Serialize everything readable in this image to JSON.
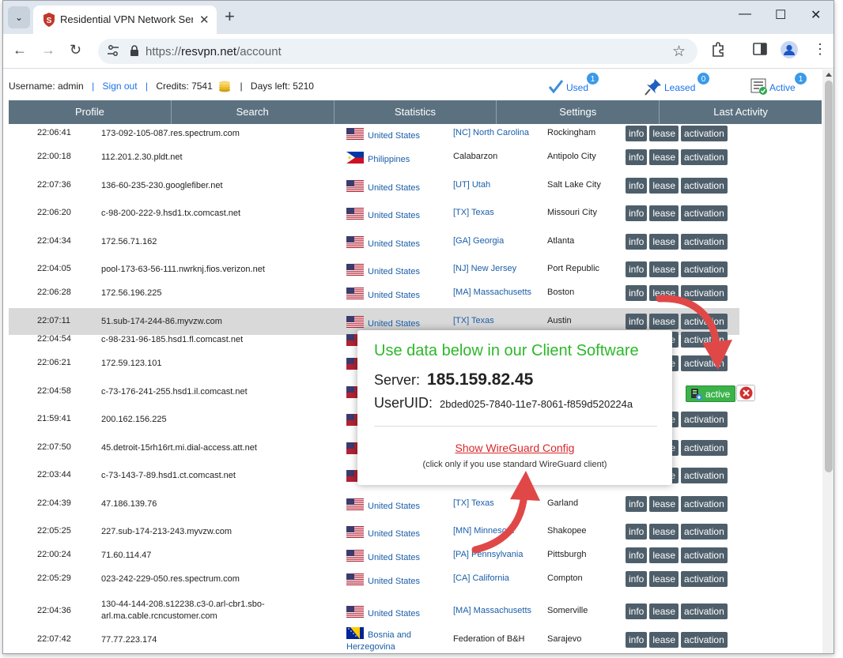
{
  "browser": {
    "tab_title": "Residential VPN Network Servic",
    "url_scheme": "https://",
    "url_host": "resvpn.net",
    "url_path": "/account"
  },
  "account": {
    "username_label": "Username: admin",
    "signout": "Sign out",
    "credits_label": "Credits: 7541",
    "days_label": "Days left: 5210"
  },
  "stats": {
    "used_label": "Used",
    "used_count": "1",
    "leased_label": "Leased",
    "leased_count": "0",
    "active_label": "Active",
    "active_count": "1"
  },
  "menu": [
    "Profile",
    "Search",
    "Statistics",
    "Settings",
    "Last Activity"
  ],
  "row_buttons": {
    "info": "info",
    "lease": "lease",
    "activation": "activation",
    "active": "active"
  },
  "rows": [
    {
      "time": "22:06:41",
      "host": "173-092-105-087.res.spectrum.com",
      "country": "United States",
      "region": "[NC] North Carolina",
      "city": "Rockingham"
    },
    {
      "time": "22:00:18",
      "host": "112.201.2.30.pldt.net",
      "country": "Philippines",
      "region": "Calabarzon",
      "city": "Antipolo City"
    },
    {
      "time": "22:07:36",
      "host": "136-60-235-230.googlefiber.net",
      "country": "United States",
      "region": "[UT] Utah",
      "city": "Salt Lake City"
    },
    {
      "time": "22:06:20",
      "host": "c-98-200-222-9.hsd1.tx.comcast.net",
      "country": "United States",
      "region": "[TX] Texas",
      "city": "Missouri City"
    },
    {
      "time": "22:04:34",
      "host": "172.56.71.162",
      "country": "United States",
      "region": "[GA] Georgia",
      "city": "Atlanta"
    },
    {
      "time": "22:04:05",
      "host": "pool-173-63-56-111.nwrknj.fios.verizon.net",
      "country": "United States",
      "region": "[NJ] New Jersey",
      "city": "Port Republic"
    },
    {
      "time": "22:06:28",
      "host": "172.56.196.225",
      "country": "United States",
      "region": "[MA] Massachusetts",
      "city": "Boston"
    },
    {
      "time": "22:07:11",
      "host": "51.sub-174-244-86.myvzw.com",
      "country": "United States",
      "region": "[TX] Texas",
      "city": "Austin"
    },
    {
      "time": "22:04:54",
      "host": "c-98-231-96-185.hsd1.fl.comcast.net",
      "country": "",
      "region": "",
      "city": ""
    },
    {
      "time": "22:06:21",
      "host": "172.59.123.101",
      "country": "",
      "region": "",
      "city": ""
    },
    {
      "time": "22:04:58",
      "host": "c-73-176-241-255.hsd1.il.comcast.net",
      "country": "",
      "region": "",
      "city": ""
    },
    {
      "time": "21:59:41",
      "host": "200.162.156.225",
      "country": "",
      "region": "",
      "city": ""
    },
    {
      "time": "22:07:50",
      "host": "45.detroit-15rh16rt.mi.dial-access.att.net",
      "country": "",
      "region": "",
      "city": ""
    },
    {
      "time": "22:03:44",
      "host": "c-73-143-7-89.hsd1.ct.comcast.net",
      "country": "",
      "region": "",
      "city": ""
    },
    {
      "time": "22:04:39",
      "host": "47.186.139.76",
      "country": "United States",
      "region": "[TX] Texas",
      "city": "Garland"
    },
    {
      "time": "22:05:25",
      "host": "227.sub-174-213-243.myvzw.com",
      "country": "United States",
      "region": "[MN] Minnesota",
      "city": "Shakopee"
    },
    {
      "time": "22:00:24",
      "host": "71.60.114.47",
      "country": "United States",
      "region": "[PA] Pennsylvania",
      "city": "Pittsburgh"
    },
    {
      "time": "22:05:29",
      "host": "023-242-229-050.res.spectrum.com",
      "country": "United States",
      "region": "[CA] California",
      "city": "Compton"
    },
    {
      "time": "22:04:36",
      "host": "130-44-144-208.s12238.c3-0.arl-cbr1.sbo-arl.ma.cable.rcncustomer.com",
      "country": "United States",
      "region": "[MA] Massachusetts",
      "city": "Somerville"
    },
    {
      "time": "22:07:42",
      "host": "77.77.223.174",
      "country": "Bosnia and Herzegovina",
      "region": "Federation of B&H",
      "city": "Sarajevo"
    }
  ],
  "popup": {
    "title": "Use data below in our Client Software",
    "server_label": "Server:",
    "server_value": "185.159.82.45",
    "uid_label": "UserUID:",
    "uid_value": "2bded025-7840-11e7-8061-f859d520224a",
    "link": "Show WireGuard Config",
    "note": "(click only if you use standard WireGuard client)"
  },
  "colors": {
    "menu_bg": "#5c7180",
    "button_bg": "#4e5f6b",
    "popup_title": "#2db82a",
    "link_red": "#d9262c",
    "active_green": "#3bb34a"
  }
}
